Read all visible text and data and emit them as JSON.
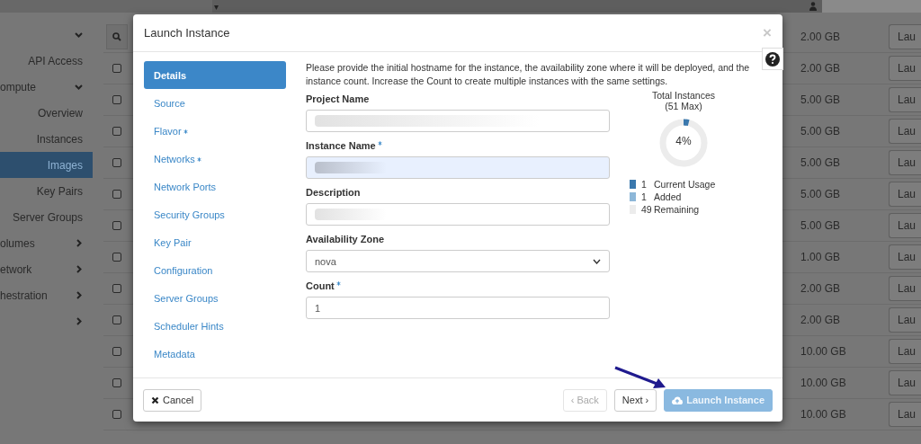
{
  "top_bar": {
    "caret": "▾"
  },
  "sidebar": {
    "items": [
      {
        "kind": "toggle",
        "expanded": true,
        "selected": false
      },
      {
        "label": "API Access",
        "kind": "link",
        "selected": false
      },
      {
        "label": "ompute",
        "kind": "toggle",
        "expanded": true,
        "selected": false
      },
      {
        "label": "Overview",
        "kind": "link",
        "selected": false
      },
      {
        "label": "Instances",
        "kind": "link",
        "selected": false
      },
      {
        "label": "Images",
        "kind": "link",
        "selected": true
      },
      {
        "label": "Key Pairs",
        "kind": "link",
        "selected": false
      },
      {
        "label": "Server Groups",
        "kind": "link",
        "selected": false
      },
      {
        "label": "olumes",
        "kind": "toggle",
        "expanded": false,
        "selected": false
      },
      {
        "label": "etwork",
        "kind": "toggle",
        "expanded": false,
        "selected": false
      },
      {
        "label": "hestration",
        "kind": "toggle",
        "expanded": false,
        "selected": false
      },
      {
        "kind": "toggle",
        "expanded": false,
        "selected": false
      }
    ]
  },
  "table": {
    "rows": [
      {
        "kind": "search",
        "size": "2.00 GB",
        "action": "Lau"
      },
      {
        "kind": "item",
        "checked": false,
        "size": "2.00 GB",
        "action": "Lau"
      },
      {
        "kind": "item",
        "checked": false,
        "size": "5.00 GB",
        "action": "Lau"
      },
      {
        "kind": "item",
        "checked": false,
        "size": "5.00 GB",
        "action": "Lau"
      },
      {
        "kind": "item",
        "checked": false,
        "size": "5.00 GB",
        "action": "Lau"
      },
      {
        "kind": "item",
        "checked": false,
        "size": "5.00 GB",
        "action": "Lau"
      },
      {
        "kind": "item",
        "checked": false,
        "size": "5.00 GB",
        "action": "Lau"
      },
      {
        "kind": "item",
        "checked": false,
        "size": "1.00 GB",
        "action": "Lau"
      },
      {
        "kind": "item",
        "checked": false,
        "size": "2.00 GB",
        "action": "Lau"
      },
      {
        "kind": "item",
        "checked": false,
        "size": "2.00 GB",
        "action": "Lau"
      },
      {
        "kind": "item",
        "checked": false,
        "size": "10.00 GB",
        "action": "Lau"
      },
      {
        "kind": "item",
        "checked": false,
        "size": "10.00 GB",
        "action": "Lau"
      },
      {
        "kind": "item",
        "checked": false,
        "size": "10.00 GB",
        "action": "Lau"
      }
    ]
  },
  "modal": {
    "title": "Launch Instance",
    "close": "×",
    "steps": [
      {
        "label": "Details",
        "required": false,
        "selected": true
      },
      {
        "label": "Source",
        "required": false,
        "selected": false
      },
      {
        "label": "Flavor",
        "required": true,
        "selected": false
      },
      {
        "label": "Networks",
        "required": true,
        "selected": false
      },
      {
        "label": "Network Ports",
        "required": false,
        "selected": false
      },
      {
        "label": "Security Groups",
        "required": false,
        "selected": false
      },
      {
        "label": "Key Pair",
        "required": false,
        "selected": false
      },
      {
        "label": "Configuration",
        "required": false,
        "selected": false
      },
      {
        "label": "Server Groups",
        "required": false,
        "selected": false
      },
      {
        "label": "Scheduler Hints",
        "required": false,
        "selected": false
      },
      {
        "label": "Metadata",
        "required": false,
        "selected": false
      }
    ],
    "description": "Please provide the initial hostname for the instance, the availability zone where it will be deployed, and the instance count. Increase the Count to create multiple instances with the same settings.",
    "fields": [
      {
        "label": "Project Name",
        "required": false,
        "kind": "text",
        "redacted": true,
        "focused": false
      },
      {
        "label": "Instance Name",
        "required": true,
        "kind": "text",
        "redacted": true,
        "focused": true
      },
      {
        "label": "Description",
        "required": false,
        "kind": "text",
        "redacted": true,
        "focused": false
      },
      {
        "label": "Availability Zone",
        "required": false,
        "kind": "select",
        "value": "nova",
        "redacted": false,
        "focused": false
      },
      {
        "label": "Count",
        "required": true,
        "kind": "number",
        "value": "1",
        "redacted": false,
        "focused": false
      }
    ],
    "quota": {
      "title": "Total Instances",
      "max": "(51 Max)",
      "percent": "4%",
      "level": 0.04,
      "legend": [
        {
          "count": "1",
          "label": "Current Usage",
          "color": "#3a78ad"
        },
        {
          "count": "1",
          "label": "Added",
          "color": "#8db7d8"
        },
        {
          "count": "49",
          "label": "Remaining",
          "color": "#ececec"
        }
      ]
    },
    "buttons": [
      {
        "label": "Cancel",
        "kind": "cancel",
        "disabled": false
      },
      {
        "label": "‹ Back",
        "kind": "default",
        "disabled": true
      },
      {
        "label": "Next ›",
        "kind": "default",
        "disabled": false
      },
      {
        "label": "Launch Instance",
        "kind": "primary",
        "disabled": true
      }
    ]
  }
}
